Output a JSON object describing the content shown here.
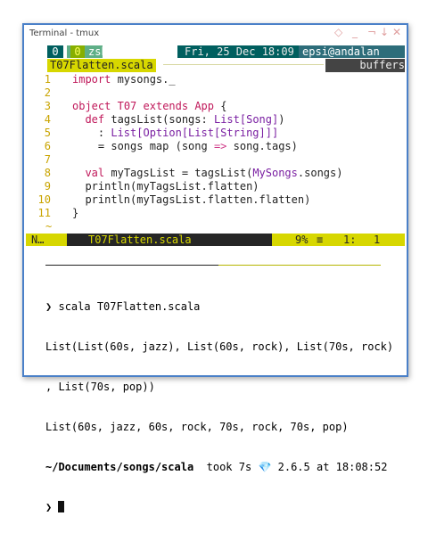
{
  "window": {
    "title": "Terminal - tmux",
    "buttons": [
      "◇",
      "_",
      "¬",
      "↓",
      "✕"
    ]
  },
  "tmux": {
    "session": "0",
    "window_index": "0",
    "window_name": "zsh",
    "datetime": "Fri, 25 Dec 18:09",
    "user_host": "epsi@andalan"
  },
  "editor": {
    "filename": "T07Flatten.scala",
    "buffers_label": "buffers",
    "tilde": "~",
    "lines": [
      {
        "n": "1",
        "parts": [
          [
            "k",
            "import"
          ],
          [
            "p",
            " mysongs._"
          ]
        ]
      },
      {
        "n": "2",
        "parts": []
      },
      {
        "n": "3",
        "parts": [
          [
            "k",
            "object"
          ],
          [
            "p",
            " "
          ],
          [
            "k",
            "T07"
          ],
          [
            "p",
            " "
          ],
          [
            "k",
            "extends"
          ],
          [
            "p",
            " "
          ],
          [
            "k",
            "App"
          ],
          [
            "p",
            " {"
          ]
        ]
      },
      {
        "n": "4",
        "parts": [
          [
            "p",
            "  "
          ],
          [
            "k",
            "def"
          ],
          [
            "p",
            " tagsList(songs: "
          ],
          [
            "t",
            "List[Song]"
          ],
          [
            "p",
            ")"
          ]
        ]
      },
      {
        "n": "5",
        "parts": [
          [
            "p",
            "    : "
          ],
          [
            "t",
            "List[Option[List[String]]]"
          ]
        ]
      },
      {
        "n": "6",
        "parts": [
          [
            "p",
            "    = songs map (song "
          ],
          [
            "o",
            "=>"
          ],
          [
            "p",
            " song.tags)"
          ]
        ]
      },
      {
        "n": "7",
        "parts": []
      },
      {
        "n": "8",
        "parts": [
          [
            "p",
            "  "
          ],
          [
            "k",
            "val"
          ],
          [
            "p",
            " myTagsList = tagsList("
          ],
          [
            "t",
            "MySongs"
          ],
          [
            "p",
            ".songs)"
          ]
        ]
      },
      {
        "n": "9",
        "parts": [
          [
            "p",
            "  println(myTagsList.flatten)"
          ]
        ]
      },
      {
        "n": "10",
        "parts": [
          [
            "p",
            "  println(myTagsList.flatten.flatten)"
          ]
        ]
      },
      {
        "n": "11",
        "parts": [
          [
            "p",
            "}"
          ]
        ]
      }
    ]
  },
  "statusline": {
    "mode": "N…",
    "filename": "T07Flatten.scala",
    "percent": "9%",
    "pos_line": "1:",
    "pos_col": "1"
  },
  "terminal": {
    "prompt_symbol": "❯",
    "command": "scala T07Flatten.scala",
    "output": [
      "List(List(60s, jazz), List(60s, rock), List(70s, rock)",
      ", List(70s, pop))",
      "List(60s, jazz, 60s, rock, 70s, rock, 70s, pop)"
    ],
    "path_prefix": "~/Documents/songs/",
    "path_dir": "scala",
    "took": "took 7s",
    "version": "2.6.5",
    "at_time": "at 18:08:52"
  },
  "colors": {
    "frame_border": "#4a80c8",
    "tmux_green": "#87af00",
    "tmux_teal": "#005f5f",
    "statusbar_bg": "#262626",
    "accent_yellow": "#d7d700"
  }
}
